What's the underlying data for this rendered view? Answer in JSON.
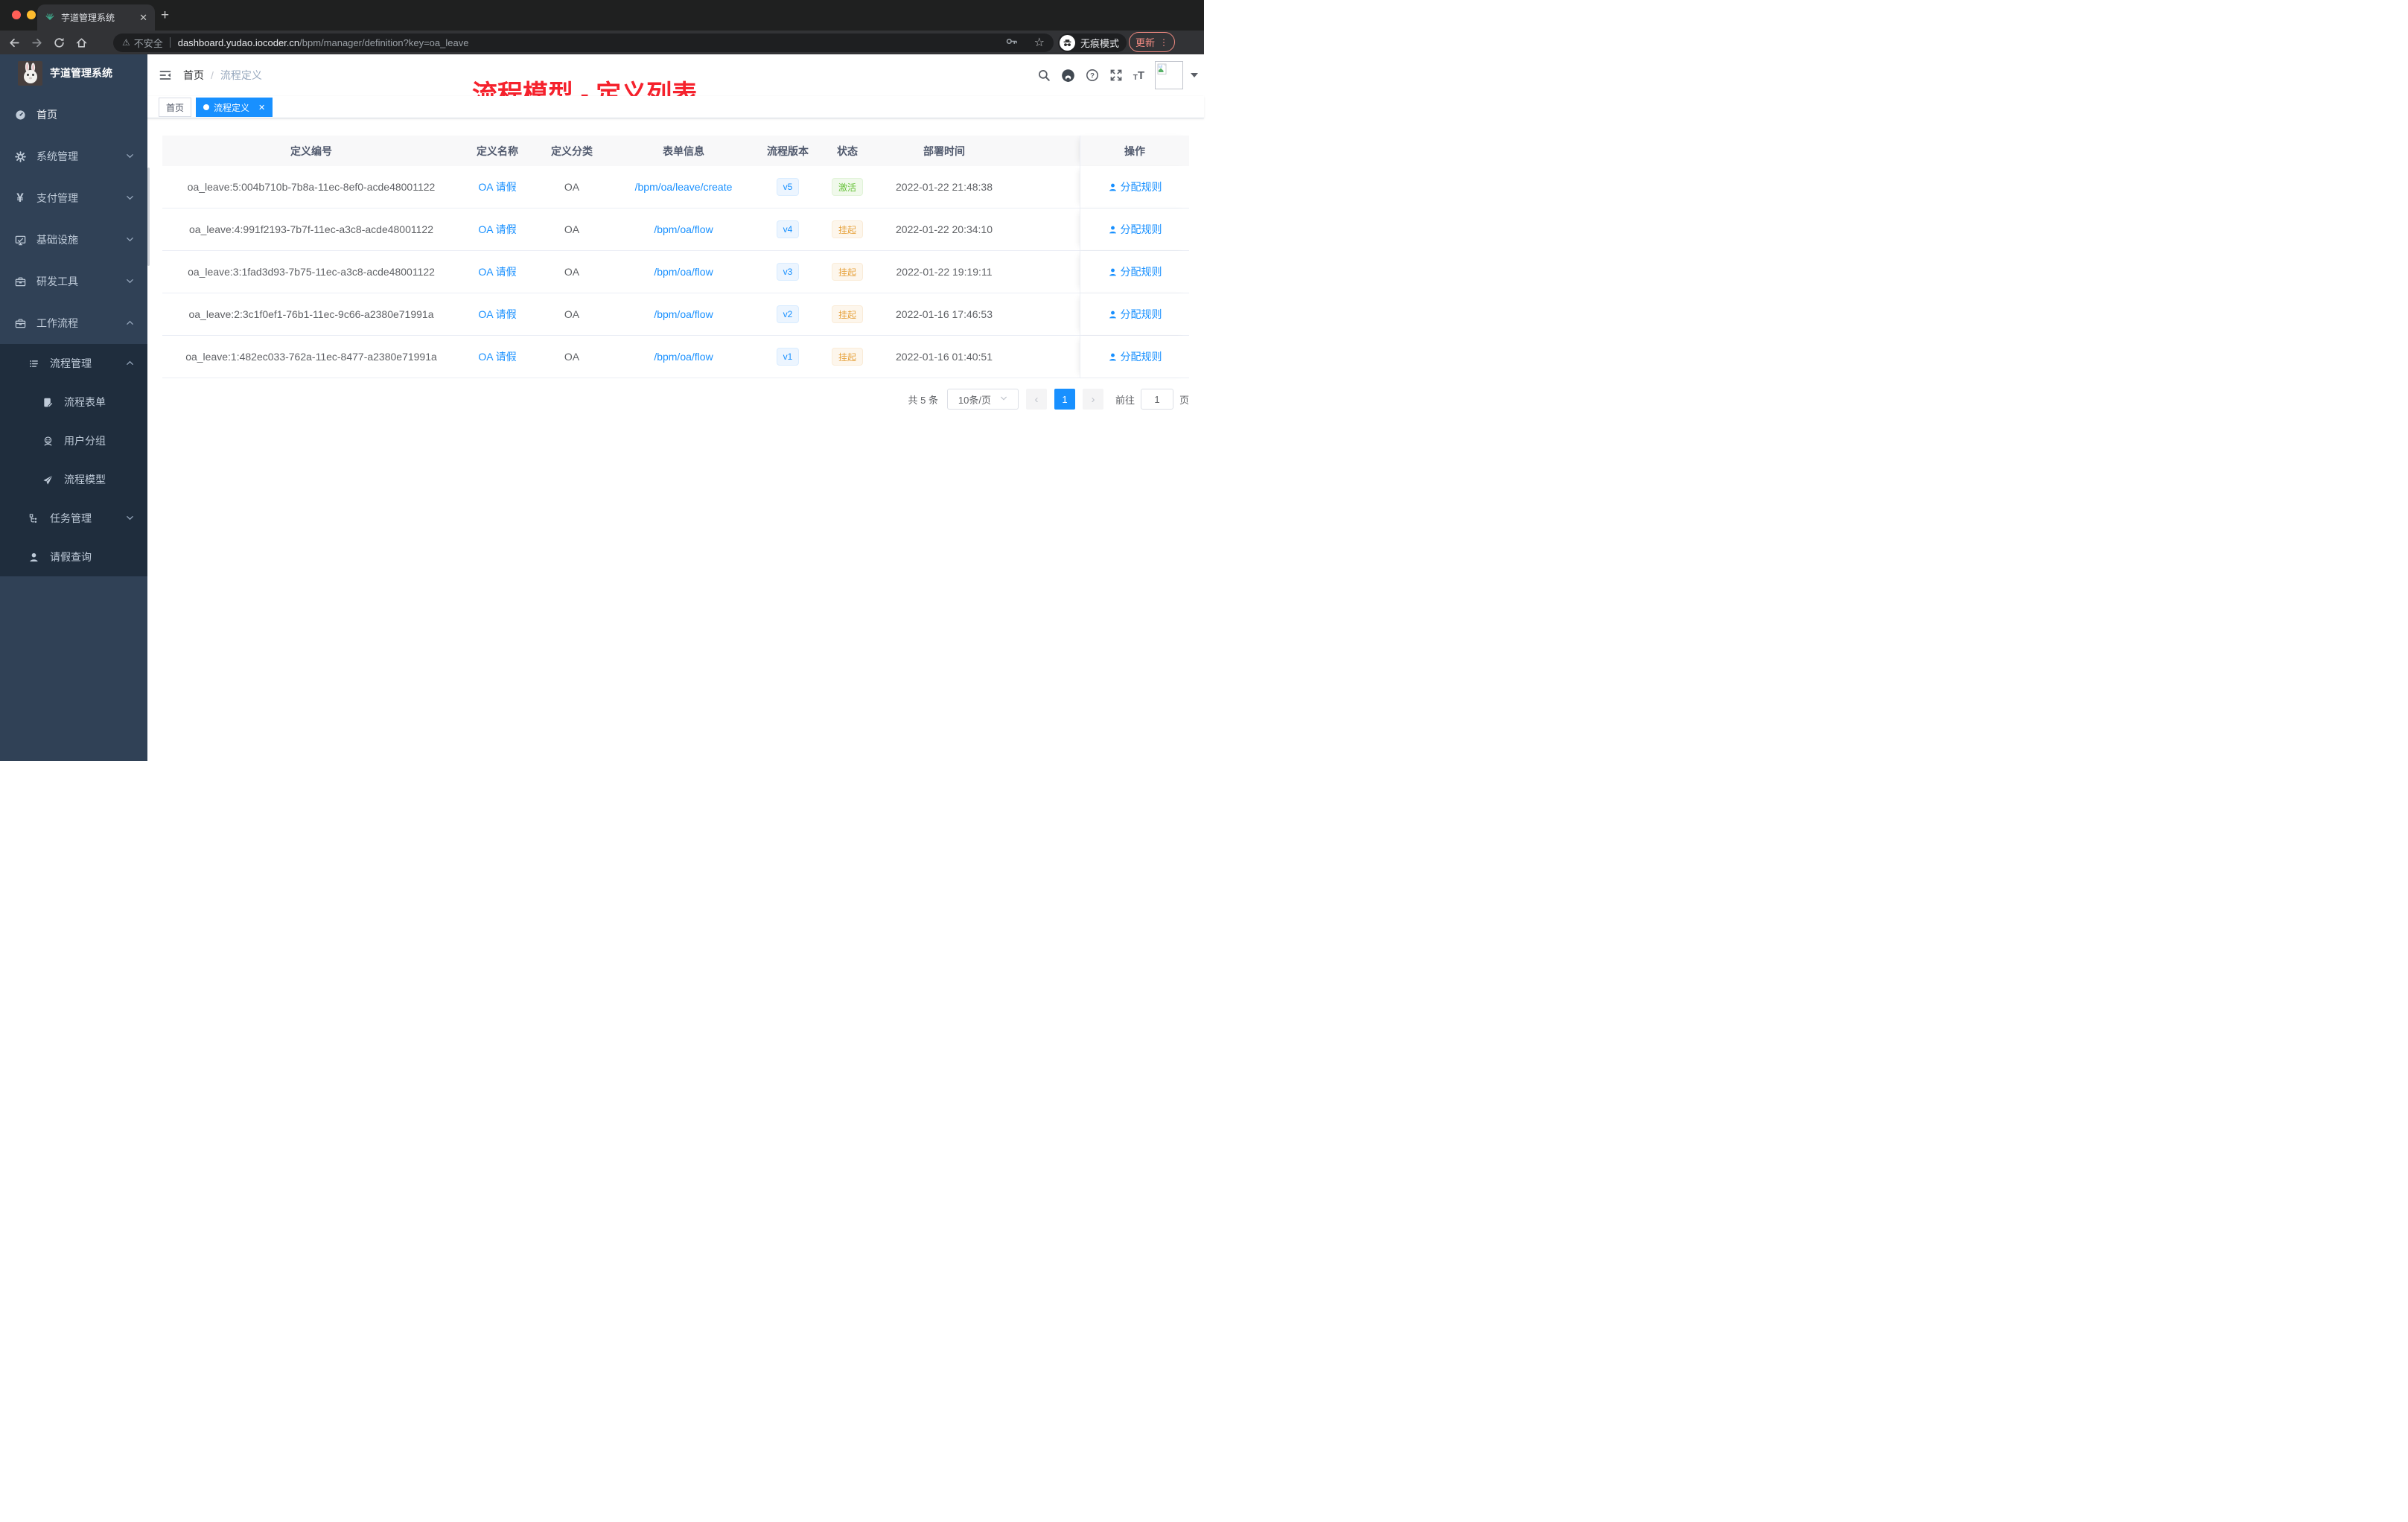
{
  "colors": {
    "primary": "#1890ff",
    "success": "#67c23a",
    "warning": "#e6a23c",
    "annotation_red": "#f5222d",
    "sidebar_bg": "#304156",
    "submenu_bg": "#1f2d3d",
    "tab_active_bg": "#1890ff"
  },
  "glyphs": {
    "close": "✕",
    "plus": "+",
    "warning": "⚠",
    "star": "☆",
    "dots": "⋮",
    "prev": "‹",
    "next": "›",
    "select_caret": "▾",
    "breadcrumb_sep": "/",
    "tag_close": "✕",
    "yen": "¥",
    "tt_small": "T",
    "tt_big": "T",
    "question": "?"
  },
  "browser": {
    "tab_title": "芋道管理系统",
    "security_label": "不安全",
    "url_host": "dashboard.yudao.iocoder.cn",
    "url_path": "/bpm/manager/definition?key=oa_leave",
    "incognito_label": "无痕模式",
    "update_label": "更新"
  },
  "sidebar": {
    "logo_title": "芋道管理系统",
    "items": [
      {
        "label": "首页",
        "icon": "dashboard-icon"
      },
      {
        "label": "系统管理",
        "icon": "gear-icon"
      },
      {
        "label": "支付管理",
        "icon": "yen-icon"
      },
      {
        "label": "基础设施",
        "icon": "monitor-icon"
      },
      {
        "label": "研发工具",
        "icon": "briefcase-icon"
      },
      {
        "label": "工作流程",
        "icon": "briefcase-icon"
      },
      {
        "label": "流程管理",
        "icon": "list-icon"
      },
      {
        "label": "流程表单",
        "icon": "form-icon"
      },
      {
        "label": "用户分组",
        "icon": "user-group-icon"
      },
      {
        "label": "流程模型",
        "icon": "paper-plane-icon"
      },
      {
        "label": "任务管理",
        "icon": "tree-icon"
      },
      {
        "label": "请假查询",
        "icon": "person-icon"
      }
    ]
  },
  "header": {
    "breadcrumb_home": "首页",
    "breadcrumb_current": "流程定义",
    "annotation": "流程模型 - 定义列表"
  },
  "tags": {
    "home": "首页",
    "active": "流程定义"
  },
  "table": {
    "columns": [
      "定义编号",
      "定义名称",
      "定义分类",
      "表单信息",
      "流程版本",
      "状态",
      "部署时间",
      "操作"
    ],
    "rows": [
      {
        "id": "oa_leave:5:004b710b-7b8a-11ec-8ef0-acde48001122",
        "name": "OA 请假",
        "category": "OA",
        "form": "/bpm/oa/leave/create",
        "version": "v5",
        "status": "激活",
        "status_class": "tag-pill badge success",
        "deploy_time": "2022-01-22 21:48:38",
        "action": "分配规则"
      },
      {
        "id": "oa_leave:4:991f2193-7b7f-11ec-a3c8-acde48001122",
        "name": "OA 请假",
        "category": "OA",
        "form": "/bpm/oa/flow",
        "version": "v4",
        "status": "挂起",
        "status_class": "tag-pill badge warning",
        "deploy_time": "2022-01-22 20:34:10",
        "action": "分配规则"
      },
      {
        "id": "oa_leave:3:1fad3d93-7b75-11ec-a3c8-acde48001122",
        "name": "OA 请假",
        "category": "OA",
        "form": "/bpm/oa/flow",
        "version": "v3",
        "status": "挂起",
        "status_class": "tag-pill badge warning",
        "deploy_time": "2022-01-22 19:19:11",
        "action": "分配规则"
      },
      {
        "id": "oa_leave:2:3c1f0ef1-76b1-11ec-9c66-a2380e71991a",
        "name": "OA 请假",
        "category": "OA",
        "form": "/bpm/oa/flow",
        "version": "v2",
        "status": "挂起",
        "status_class": "tag-pill badge warning",
        "deploy_time": "2022-01-16 17:46:53",
        "action": "分配规则"
      },
      {
        "id": "oa_leave:1:482ec033-762a-11ec-8477-a2380e71991a",
        "name": "OA 请假",
        "category": "OA",
        "form": "/bpm/oa/flow",
        "version": "v1",
        "status": "挂起",
        "status_class": "tag-pill badge warning",
        "deploy_time": "2022-01-16 01:40:51",
        "action": "分配规则"
      }
    ]
  },
  "pagination": {
    "total_label": "共 5 条",
    "page_size_label": "10条/页",
    "current_page": "1",
    "goto_label": "前往",
    "goto_value": "1",
    "page_suffix": "页"
  }
}
